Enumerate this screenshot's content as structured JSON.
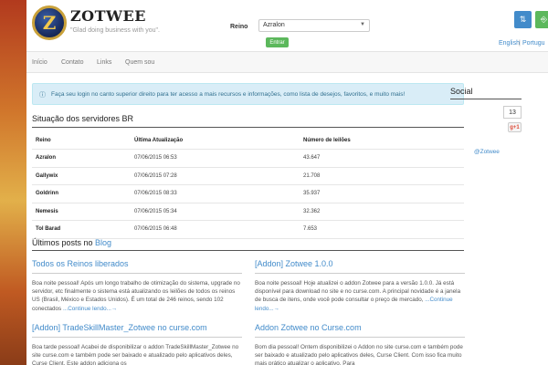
{
  "header": {
    "logo_letter": "Z",
    "brand": "ZOTWEE",
    "tagline": "\"Glad doing business with you\".",
    "realm_label": "Reino",
    "realm_selected": "Azralon",
    "enter_button": "Entrar",
    "lang_en": "English",
    "lang_sep": "|",
    "lang_pt": "Portugu"
  },
  "nav": {
    "items": [
      "Início",
      "Contato",
      "Links",
      "Quem sou"
    ]
  },
  "alert": {
    "text": "Faça seu login no canto superior direito para ter acesso a mais recursos e informações, como lista de desejos, favoritos, e muito mais!"
  },
  "servers": {
    "title": "Situação dos servidores BR",
    "columns": [
      "Reino",
      "Última Atualização",
      "Número de leilões"
    ],
    "rows": [
      {
        "realm": "Azralon",
        "updated": "07/06/2015 06:53",
        "auctions": "43.647"
      },
      {
        "realm": "Gallywix",
        "updated": "07/06/2015 07:28",
        "auctions": "21.708"
      },
      {
        "realm": "Goldrinn",
        "updated": "07/06/2015 08:33",
        "auctions": "35.937"
      },
      {
        "realm": "Nemesis",
        "updated": "07/06/2015 05:34",
        "auctions": "32.362"
      },
      {
        "realm": "Tol Barad",
        "updated": "07/06/2015 06:48",
        "auctions": "7.653"
      }
    ]
  },
  "posts": {
    "title_prefix": "Últimos posts no",
    "title_link": "Blog",
    "items": [
      {
        "title": "Todos os Reinos liberados",
        "body": "Boa noite pessoal! Após um longo trabalho de otimização do sistema, upgrade no servidor, etc finalmente o sistema está atualizando os leilões de todos os reinos US (Brasil, México e Estados Unidos). É um total de 246 reinos, sendo 102 conectados",
        "more": "...Continue lendo...→"
      },
      {
        "title": "[Addon] Zotwee 1.0.0",
        "body": "Boa noite pessoal! Hoje atualizei o addon Zotwee para a versão 1.0.0. Já está disponível para download no site e no curse.com. A principal novidade é a janela de busca de itens, onde você pode consultar o preço de mercado,",
        "more": "...Continue lendo...→"
      },
      {
        "title": "[Addon] TradeSkillMaster_Zotwee no curse.com",
        "body": "Boa tarde pessoal! Acabei de disponibilizar o addon TradeSkillMaster_Zotwee no site curse.com e também pode ser baixado e atualizado pelo aplicativos deles, Curse Client. Este addon adiciona os",
        "more": ""
      },
      {
        "title": "Addon Zotwee no Curse.com",
        "body": "Bom dia pessoal! Ontem disponibilizei o Addon no site curse.com e também pode ser baixado e atualizado pelo aplicativos deles, Curse Client. Com isso fica muito mais prático atualizar o aplicativo. Para",
        "more": ""
      }
    ]
  },
  "social": {
    "title": "Social",
    "count": "13",
    "gplus": "g+1",
    "twitter": "@Zotwee"
  },
  "icons": {
    "sort": "⇅",
    "login": "⎆",
    "info": "ⓘ"
  }
}
